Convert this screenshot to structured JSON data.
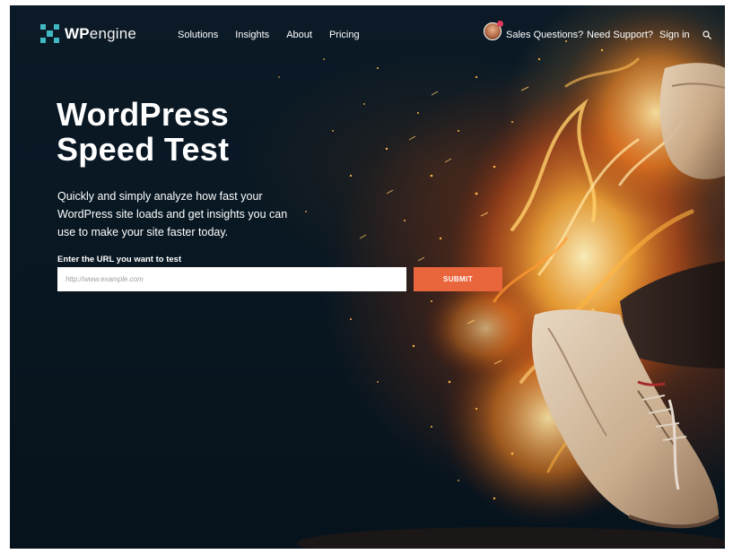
{
  "brand": {
    "logo_bold": "WP",
    "logo_light": "engine",
    "accent_color": "#3fb8c4"
  },
  "nav": {
    "left_items": [
      {
        "label": "Solutions"
      },
      {
        "label": "Insights"
      },
      {
        "label": "About"
      },
      {
        "label": "Pricing"
      }
    ],
    "sales_label": "Sales Questions?",
    "support_label": "Need Support?",
    "signin_label": "Sign in",
    "search_icon": "search-icon",
    "avatar_icon": "sales-rep-avatar"
  },
  "hero": {
    "title_line1": "WordPress",
    "title_line2": "Speed Test",
    "description": "Quickly and simply analyze how fast your WordPress site loads and get insights you can use to make your site faster today."
  },
  "form": {
    "label": "Enter the URL you want to test",
    "url_value": "",
    "url_placeholder": "http://www.example.com",
    "submit_label": "SUBMIT",
    "submit_color": "#e9653b"
  }
}
